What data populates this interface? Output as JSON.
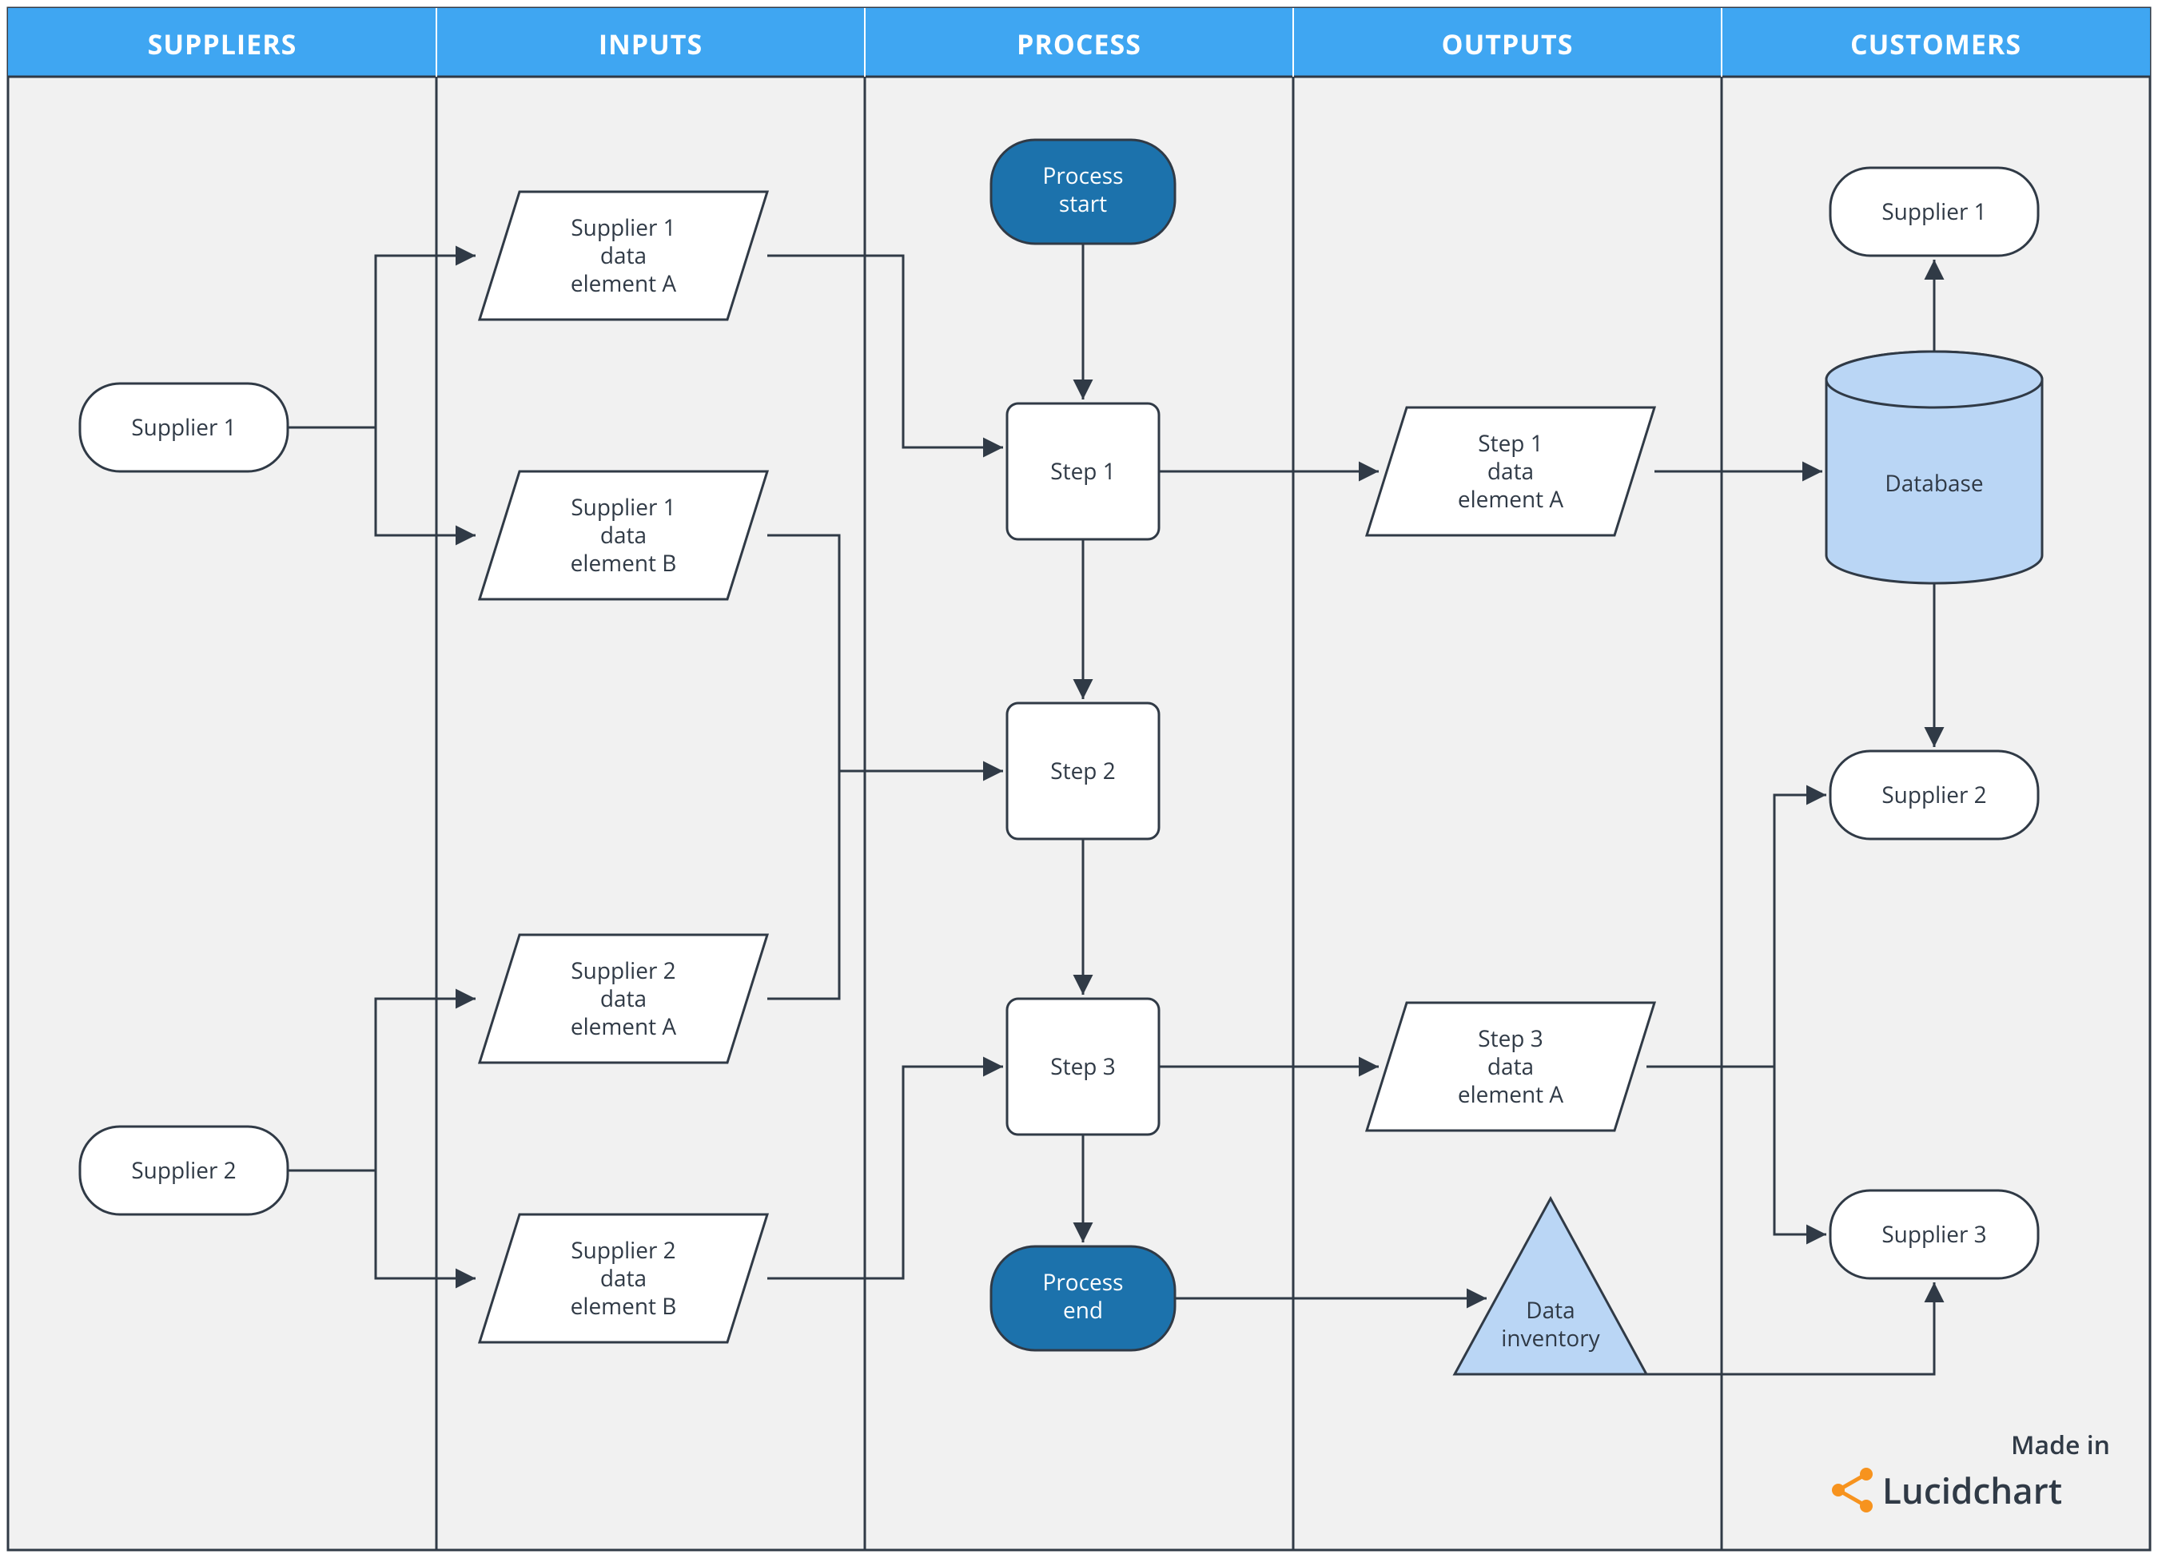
{
  "columns": {
    "suppliers": "SUPPLIERS",
    "inputs": "INPUTS",
    "process": "PROCESS",
    "outputs": "OUTPUTS",
    "customers": "CUSTOMERS"
  },
  "nodes": {
    "supplier1": "Supplier 1",
    "supplier2": "Supplier 2",
    "in_s1a_l1": "Supplier 1",
    "in_s1a_l2": "data",
    "in_s1a_l3": "element A",
    "in_s1b_l1": "Supplier 1",
    "in_s1b_l2": "data",
    "in_s1b_l3": "element B",
    "in_s2a_l1": "Supplier 2",
    "in_s2a_l2": "data",
    "in_s2a_l3": "element A",
    "in_s2b_l1": "Supplier 2",
    "in_s2b_l2": "data",
    "in_s2b_l3": "element B",
    "pstart_l1": "Process",
    "pstart_l2": "start",
    "step1": "Step 1",
    "step2": "Step 2",
    "step3": "Step 3",
    "pend_l1": "Process",
    "pend_l2": "end",
    "out1_l1": "Step 1",
    "out1_l2": "data",
    "out1_l3": "element A",
    "out3_l1": "Step 3",
    "out3_l2": "data",
    "out3_l3": "element A",
    "inv_l1": "Data",
    "inv_l2": "inventory",
    "cust1": "Supplier 1",
    "cust2": "Supplier 2",
    "cust3": "Supplier 3",
    "database": "Database"
  },
  "branding": {
    "madein": "Made in",
    "name": "Lucidchart"
  }
}
